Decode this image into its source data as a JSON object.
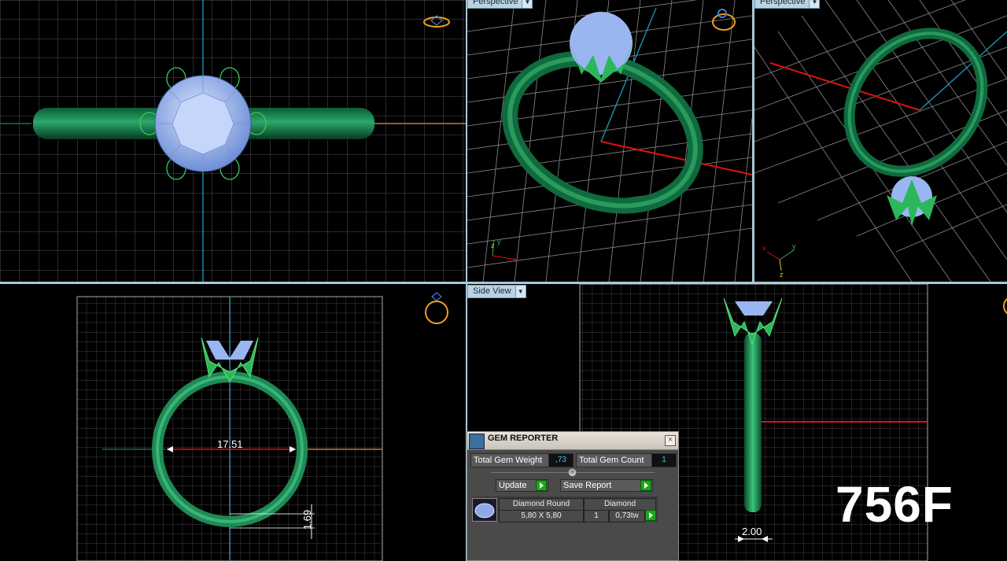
{
  "viewports": {
    "top_right": {
      "label": "Perspective"
    },
    "far_right": {
      "label": "Perspective"
    },
    "side": {
      "label": "Side View"
    }
  },
  "dimensions": {
    "inner_diameter": "17.51",
    "band_thickness": "1.69",
    "band_width": "2.00"
  },
  "big_label": "756F",
  "gem_reporter": {
    "title": "GEM REPORTER",
    "close": "×",
    "total_gem_weight_label": "Total Gem Weight",
    "total_gem_weight": ",73",
    "total_gem_count_label": "Total Gem Count",
    "total_gem_count": "1",
    "update_label": "Update",
    "save_report_label": "Save Report",
    "gem": {
      "name": "Diamond Round",
      "material": "Diamond",
      "size": "5,80 X 5,80",
      "count": "1",
      "weight": "0,73tw"
    }
  },
  "colors": {
    "band": "#1a7a4a",
    "gem": "#8fb0f0",
    "grid": "#9a9a9a",
    "icon": "#f0a020",
    "accent_red": "#e01010",
    "accent_blue": "#1a8aa8"
  }
}
